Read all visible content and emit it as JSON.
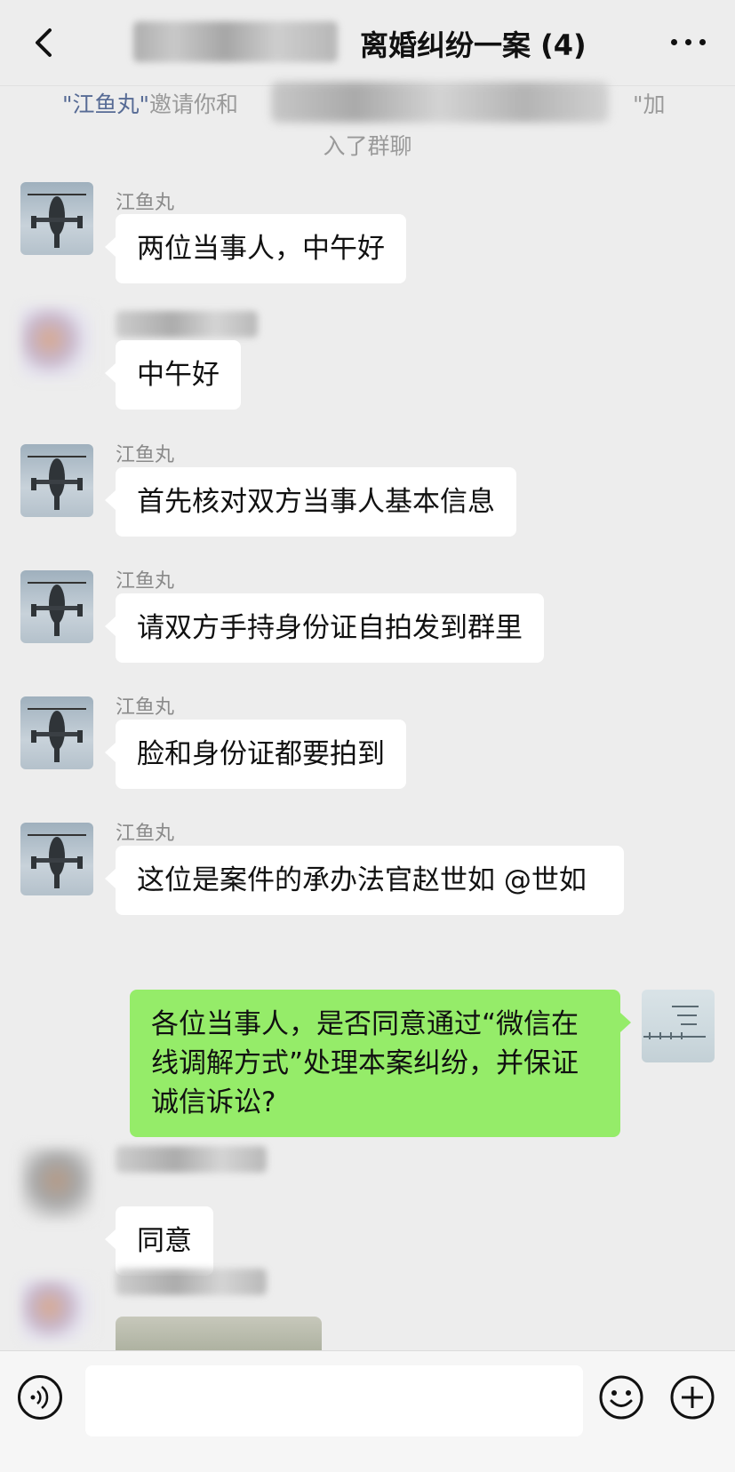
{
  "header": {
    "title": "离婚纠纷一案 (4)"
  },
  "system_notice": {
    "inviter": "\"江鱼丸\"",
    "invite_text": "邀请你和",
    "tail": "\"加",
    "line2": "入了群聊"
  },
  "messages": [
    {
      "sender": "江鱼丸",
      "text": "两位当事人，中午好"
    },
    {
      "sender": "",
      "text": "中午好"
    },
    {
      "sender": "江鱼丸",
      "text": "首先核对双方当事人基本信息"
    },
    {
      "sender": "江鱼丸",
      "text": "请双方手持身份证自拍发到群里"
    },
    {
      "sender": "江鱼丸",
      "text": "脸和身份证都要拍到"
    },
    {
      "sender": "江鱼丸",
      "text": "这位是案件的承办法官赵世如 @世如"
    },
    {
      "sender": "me",
      "text": "各位当事人，是否同意通过“微信在线调解方式”处理本案纠纷，并保证诚信诉讼?"
    },
    {
      "sender": "",
      "text": "同意"
    }
  ],
  "input_bar": {
    "placeholder": ""
  },
  "icons": {
    "back": "chevron-left-icon",
    "more": "more-icon",
    "voice": "voice-icon",
    "emoji": "emoji-icon",
    "plus": "plus-icon"
  },
  "colors": {
    "background": "#ededed",
    "bubble_self": "#95ec69",
    "bubble_other": "#ffffff",
    "link": "#576b95"
  }
}
